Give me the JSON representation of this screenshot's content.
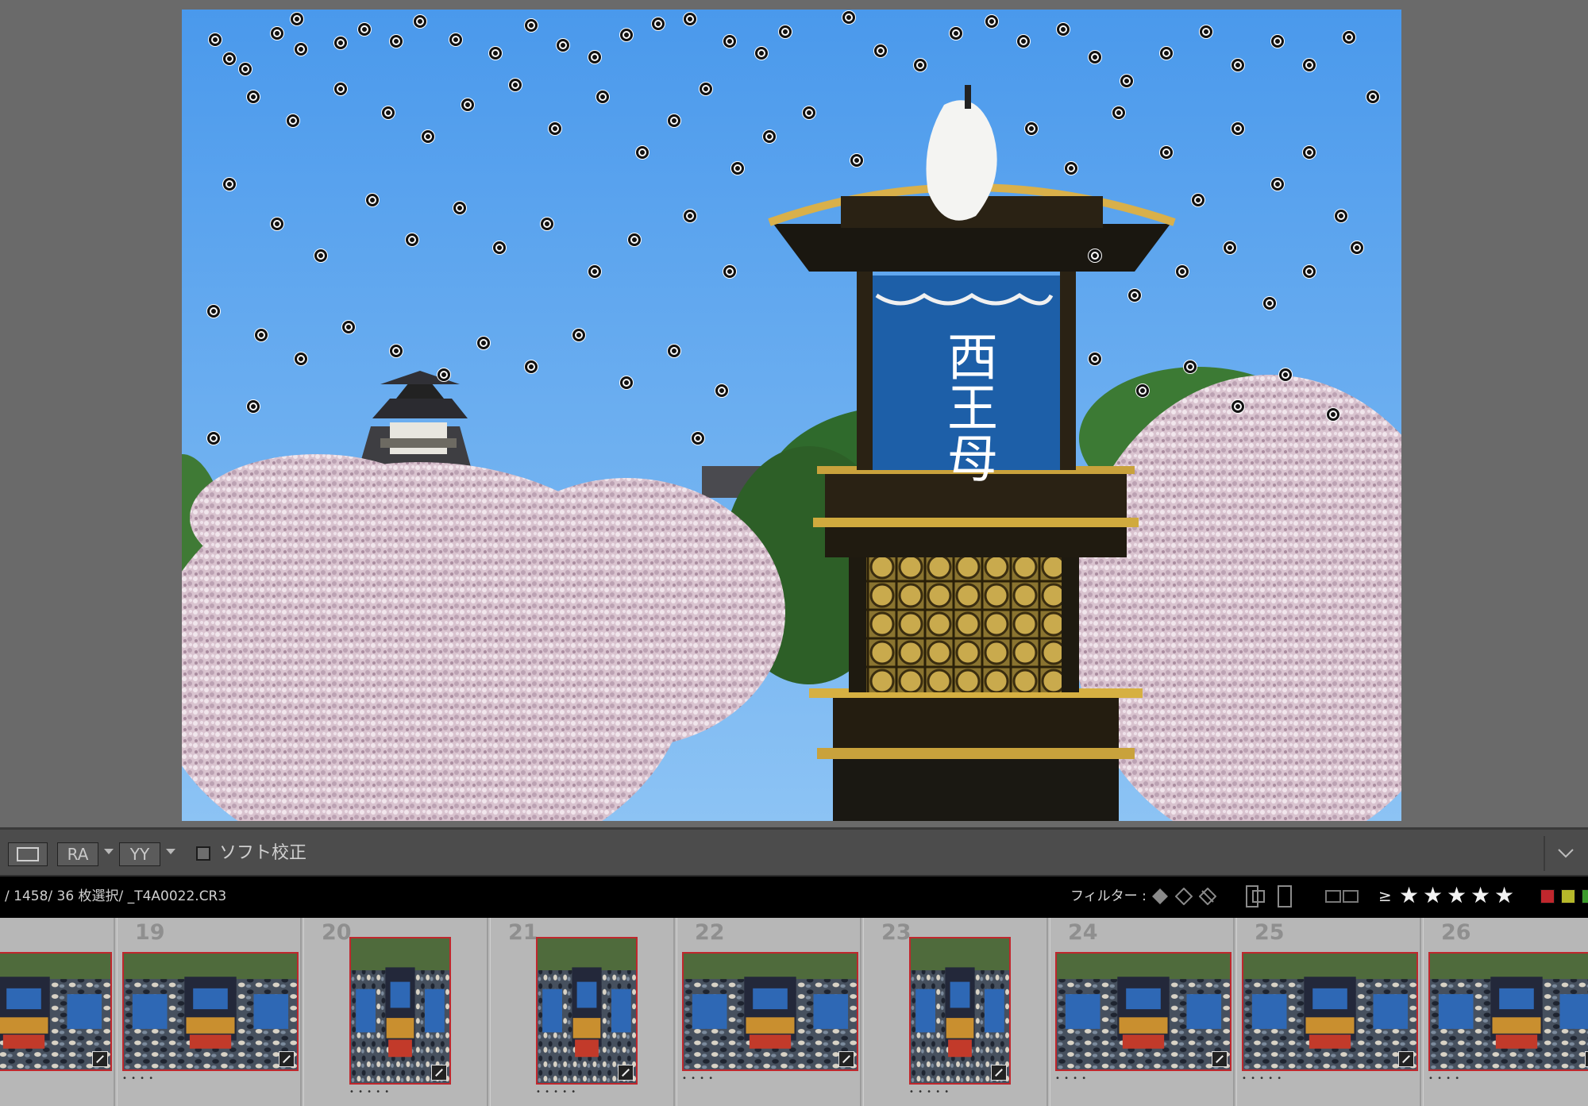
{
  "toolbar": {
    "view_loupe": "loupe-view",
    "compare_ra": "RA",
    "compare_yy": "YY",
    "softproof_label": "ソフト校正"
  },
  "filmstrip_header": {
    "path": "/ 1458/ 36 枚選択/ _T4A0022.CR3",
    "filter_label": "フィルター :",
    "rating_operator": "≥",
    "stars": [
      "★",
      "★",
      "★",
      "★",
      "★"
    ],
    "color_labels": [
      "#c0272d",
      "#b6b82a",
      "#3b9a2b"
    ]
  },
  "filmstrip": {
    "cells": [
      {
        "num": "",
        "orientation": "landscape",
        "rating": ""
      },
      {
        "num": "19",
        "orientation": "landscape",
        "rating": "• • • •"
      },
      {
        "num": "20",
        "orientation": "portrait",
        "rating": "• • • • •"
      },
      {
        "num": "21",
        "orientation": "portrait",
        "rating": "• • • • •"
      },
      {
        "num": "22",
        "orientation": "landscape",
        "rating": "• • • •"
      },
      {
        "num": "23",
        "orientation": "portrait",
        "rating": "• • • • •"
      },
      {
        "num": "24",
        "orientation": "landscape",
        "rating": "• • • •"
      },
      {
        "num": "25",
        "orientation": "landscape",
        "rating": "• • • • •"
      },
      {
        "num": "26",
        "orientation": "landscape",
        "rating": "• • • •"
      }
    ]
  },
  "photo": {
    "sky_color": "#4fa0ee",
    "banner_characters": "西王母",
    "banner_color": "#1d5fa8"
  }
}
